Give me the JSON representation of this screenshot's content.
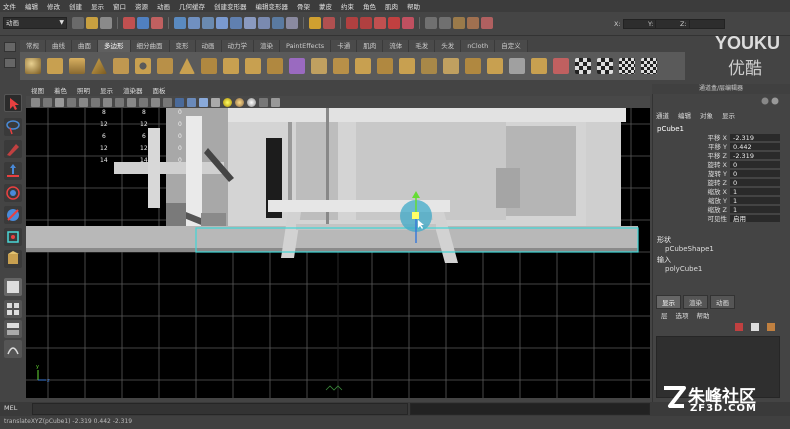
{
  "menubar": {
    "items": [
      "文件",
      "编辑",
      "修改",
      "创建",
      "显示",
      "窗口",
      "资源",
      "动画",
      "几何缓存",
      "创建变形器",
      "编辑变形器",
      "骨架",
      "蒙皮",
      "约束",
      "角色",
      "肌肉",
      "帮助"
    ]
  },
  "statusline": {
    "mode_value": "动画",
    "x_label": "X:",
    "y_label": "Y:",
    "z_label": "Z:"
  },
  "shelf": {
    "tabs": [
      "常规",
      "曲线",
      "曲面",
      "多边形",
      "细分曲面",
      "变形",
      "动画",
      "动力学",
      "渲染",
      "PaintEffects",
      "卡通",
      "肌肉",
      "流体",
      "毛发",
      "头发",
      "nCloth",
      "自定义"
    ],
    "active_tab": "多边形"
  },
  "branding": {
    "youku_latin": "YOUKU",
    "youku_cn": "优酷"
  },
  "viewport": {
    "menu": [
      "视图",
      "着色",
      "照明",
      "显示",
      "渲染器",
      "面板"
    ],
    "hud_labels": [
      "",
      "",
      "",
      "",
      ""
    ],
    "hud_col1": [
      "8",
      "12",
      "6",
      "12",
      "14"
    ],
    "hud_col2": [
      "8",
      "12",
      "6",
      "12",
      "14"
    ],
    "hud_col3": [
      "0",
      "0",
      "0",
      "0",
      "0"
    ]
  },
  "channel_box": {
    "header": "通道盒/层编辑器",
    "menu": [
      "通道",
      "编辑",
      "对象",
      "显示"
    ],
    "node_name": "pCube1",
    "attributes": [
      {
        "name": "平移 X",
        "value": "-2.319"
      },
      {
        "name": "平移 Y",
        "value": "0.442"
      },
      {
        "name": "平移 Z",
        "value": "-2.319"
      },
      {
        "name": "旋转 X",
        "value": "0"
      },
      {
        "name": "旋转 Y",
        "value": "0"
      },
      {
        "name": "旋转 Z",
        "value": "0"
      },
      {
        "name": "缩放 X",
        "value": "1"
      },
      {
        "name": "缩放 Y",
        "value": "1"
      },
      {
        "name": "缩放 Z",
        "value": "1"
      },
      {
        "name": "可见性",
        "value": "启用"
      }
    ],
    "shapes_label": "形状",
    "shape_name": "pCubeShape1",
    "inputs_label": "输入",
    "input_name": "polyCube1"
  },
  "layer_editor": {
    "tabs": [
      "显示",
      "渲染",
      "动画"
    ],
    "active_tab": "显示",
    "menu": [
      "层",
      "选项",
      "帮助"
    ]
  },
  "command_line": {
    "label": "MEL"
  },
  "help_line": {
    "text": "translateXYZ(pCube1)      -2.319      0.442      -2.319"
  },
  "watermark": {
    "main": "朱峰社区",
    "sub": "ZF3D.COM"
  },
  "colors": {
    "selection_cyan": "#3fd6d6",
    "manipulator_green": "#66dd33",
    "hud_green": "#66cc66",
    "ui_bg": "#444444"
  }
}
